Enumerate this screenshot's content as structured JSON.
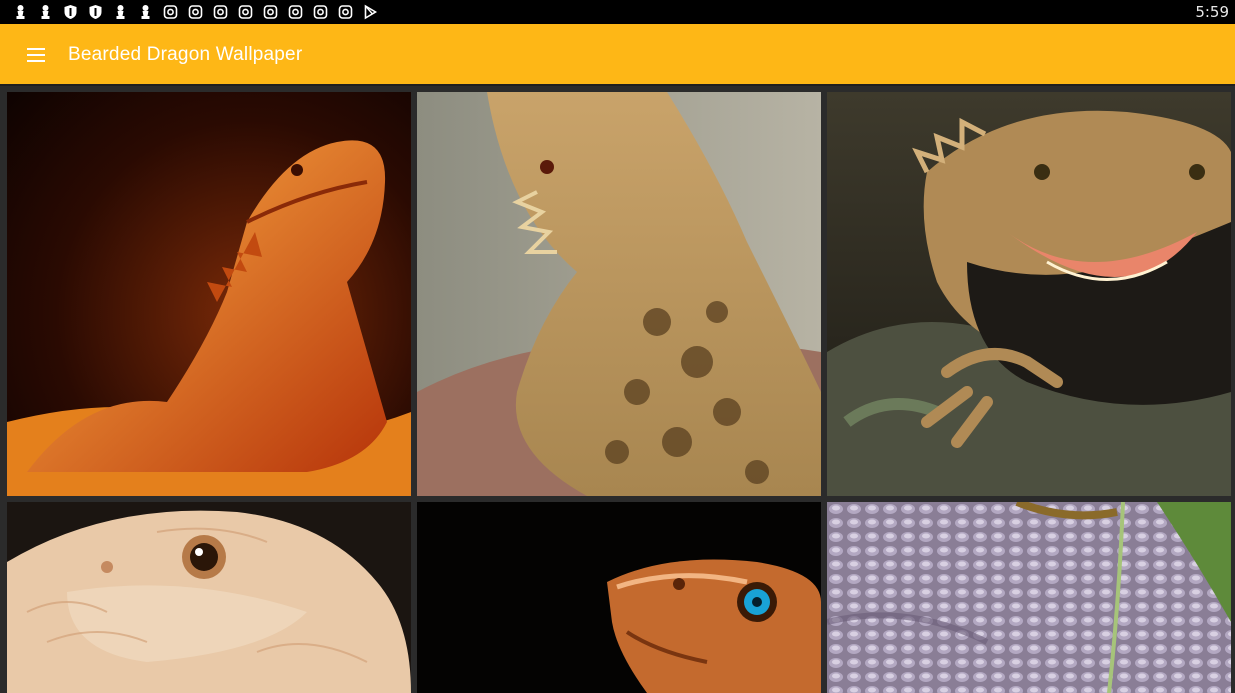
{
  "status_bar": {
    "time": "5:59",
    "notification_icons": [
      "chess-pawn-icon",
      "chess-pawn-icon",
      "shield-icon",
      "shield-icon",
      "chess-pawn-icon",
      "chess-pawn-icon",
      "instagram-icon",
      "instagram-icon",
      "instagram-icon",
      "instagram-icon",
      "instagram-icon",
      "instagram-icon",
      "instagram-icon",
      "instagram-icon",
      "play-store-icon"
    ]
  },
  "app_bar": {
    "title": "Bearded Dragon Wallpaper",
    "background_color": "#FEB716",
    "menu_icon": "hamburger-menu-icon"
  },
  "wallpapers": [
    {
      "subject": "orange bearded dragon under heat lamp"
    },
    {
      "subject": "spiky bearded dragon close-up, grey background"
    },
    {
      "subject": "bearded dragon with open mouth on rock"
    },
    {
      "subject": "pale orange bearded dragon eye close-up"
    },
    {
      "subject": "orange bearded dragon with blue eye on black"
    },
    {
      "subject": "purple-grey bearded dragon scales"
    }
  ]
}
